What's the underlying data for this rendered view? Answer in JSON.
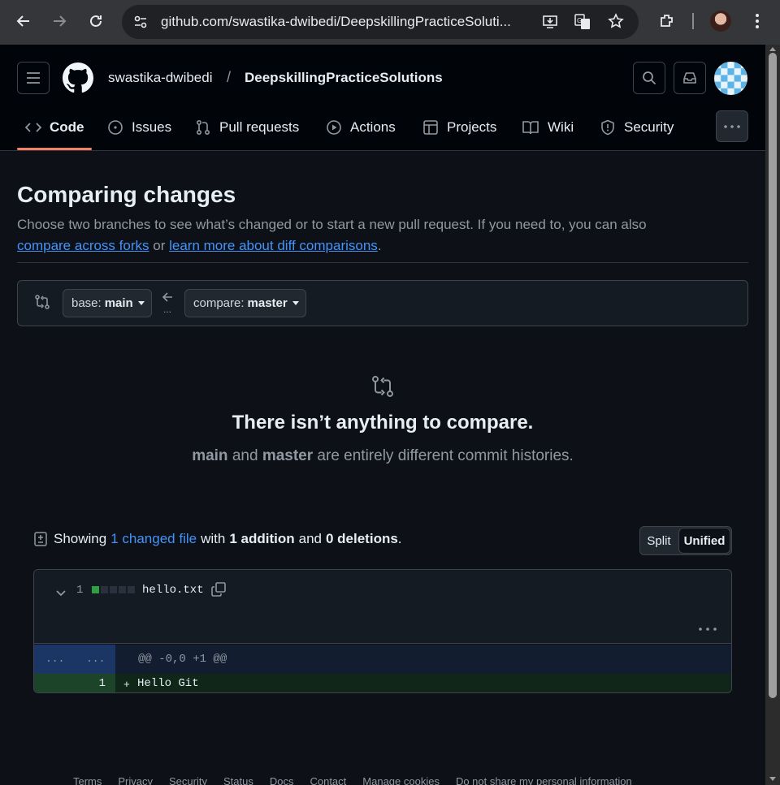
{
  "browser": {
    "url": "github.com/swastika-dwibedi/DeepskillingPracticeSoluti..."
  },
  "repo": {
    "owner": "swastika-dwibedi",
    "separator": "/",
    "name": "DeepskillingPracticeSolutions"
  },
  "tabs": [
    {
      "label": "Code",
      "icon": "code-icon",
      "active": true
    },
    {
      "label": "Issues",
      "icon": "issue-icon"
    },
    {
      "label": "Pull requests",
      "icon": "pull-request-icon"
    },
    {
      "label": "Actions",
      "icon": "play-icon"
    },
    {
      "label": "Projects",
      "icon": "table-icon"
    },
    {
      "label": "Wiki",
      "icon": "book-icon"
    },
    {
      "label": "Security",
      "icon": "shield-icon"
    }
  ],
  "compare": {
    "title": "Comparing changes",
    "description_pre": "Choose two branches to see what’s changed or to start a new pull request. If you need to, you can also",
    "link_forks": "compare across forks",
    "description_or": "or",
    "link_learn": "learn more about diff comparisons",
    "description_end": ".",
    "base_label": "base:",
    "base_value": "main",
    "compare_label": "compare:",
    "compare_value": "master",
    "dots": "..."
  },
  "blankslate": {
    "heading": "There isn’t anything to compare.",
    "branch_a": "main",
    "and": "and",
    "branch_b": "master",
    "message_rest": "are entirely different commit histories."
  },
  "toc": {
    "showing": "Showing",
    "changed_files": "1 changed file",
    "with": "with",
    "additions": "1 addition",
    "and": "and",
    "deletions": "0 deletions",
    "period": "."
  },
  "view_toggle": {
    "split": "Split",
    "unified": "Unified",
    "selected": "Unified"
  },
  "file": {
    "change_count": "1",
    "diffstat": [
      "add",
      "neutral",
      "neutral",
      "neutral",
      "neutral"
    ],
    "name": "hello.txt",
    "hunk_left": "...",
    "hunk_right": "...",
    "hunk_header": "@@ -0,0 +1 @@",
    "line_number": "1",
    "line_marker": "+",
    "line_content": "Hello Git"
  },
  "footer": [
    "Terms",
    "Privacy",
    "Security",
    "Status",
    "Docs",
    "Contact",
    "Manage cookies",
    "Do not share my personal information"
  ],
  "colors": {
    "bg": "#0d1117",
    "header_bg": "#010409",
    "link": "#4493f8",
    "accent_underline": "#f78166",
    "addition": "#2ea043"
  }
}
